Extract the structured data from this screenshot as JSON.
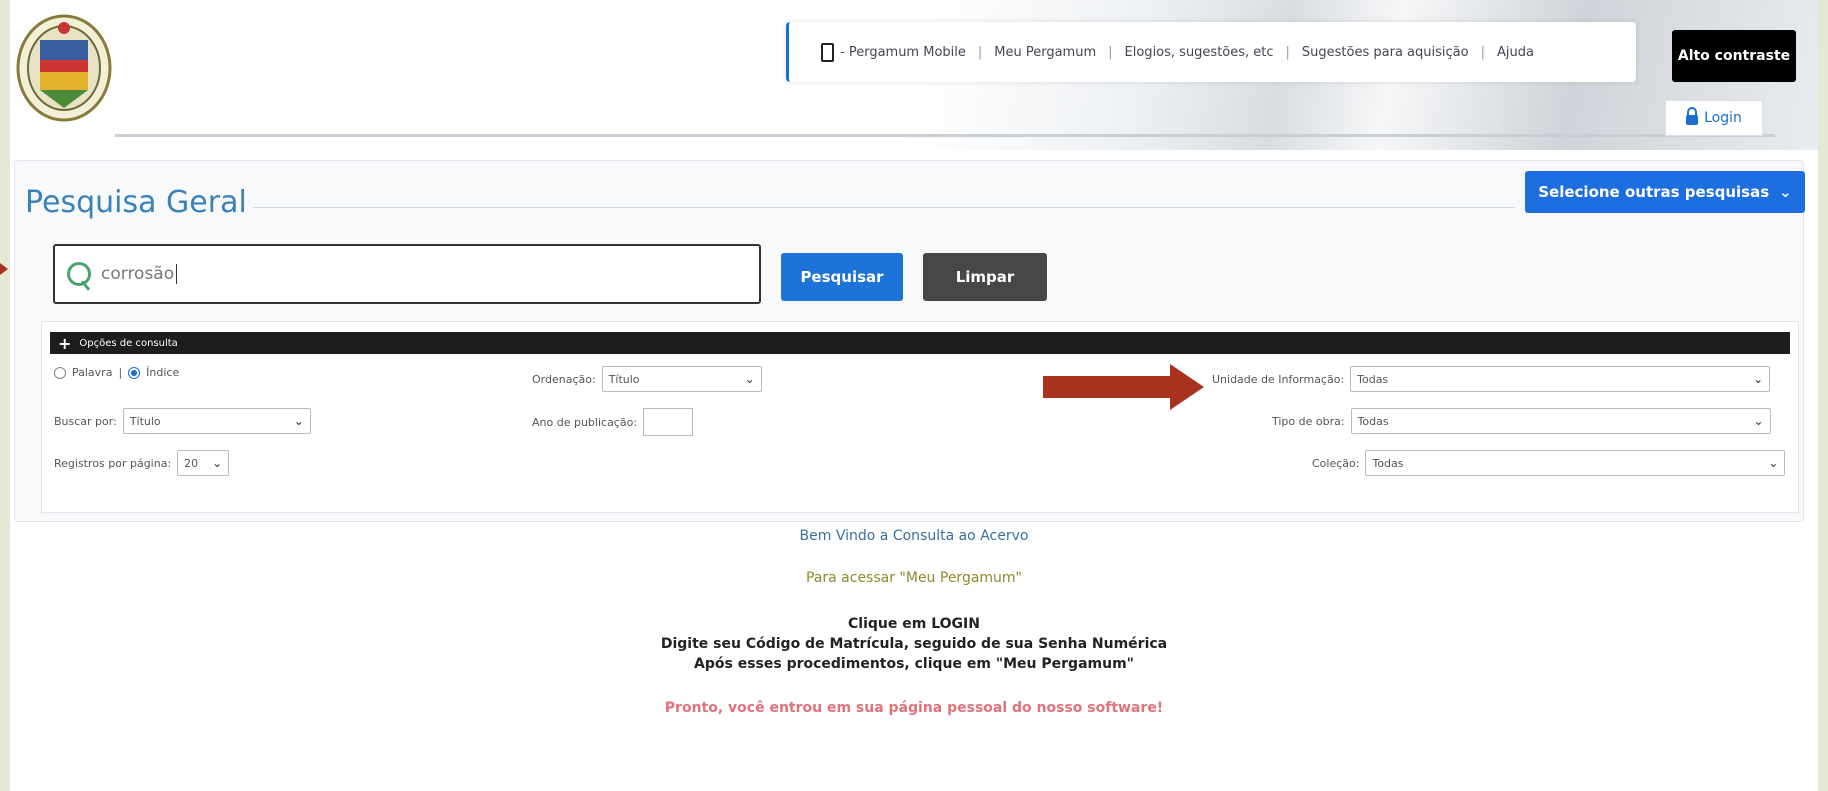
{
  "header": {
    "nav": [
      {
        "label": "- Pergamum Mobile"
      },
      {
        "label": "Meu Pergamum"
      },
      {
        "label": "Elogios, sugestões, etc"
      },
      {
        "label": "Sugestões para aquisição"
      },
      {
        "label": "Ajuda"
      }
    ],
    "high_contrast": "Alto contraste",
    "login": "Login"
  },
  "search": {
    "title": "Pesquisa Geral",
    "other_searches": "Selecione outras pesquisas",
    "query": "corrosão",
    "search_button": "Pesquisar",
    "clear_button": "Limpar"
  },
  "options": {
    "bar_label": "Opções de consulta",
    "radio_word": "Palavra",
    "radio_index": "Índice",
    "order_label": "Ordenação:",
    "order_value": "Título",
    "unit_label": "Unidade de Informação:",
    "unit_value": "Todas",
    "search_by_label": "Buscar por:",
    "search_by_value": "Título",
    "year_label": "Ano de publicação:",
    "year_value": "",
    "type_label": "Tipo de obra:",
    "type_value": "Todas",
    "per_page_label": "Registros por página:",
    "per_page_value": "20",
    "collection_label": "Coleção:",
    "collection_value": "Todas"
  },
  "welcome": {
    "line1": "Bem Vindo a Consulta ao Acervo",
    "line2": "Para acessar \"Meu Pergamum\"",
    "line3a": "Clique em LOGIN",
    "line3b": "Digite seu Código de Matrícula, seguido de sua Senha Numérica",
    "line3c": "Após esses procedimentos, clique em \"Meu Pergamum\"",
    "line4": "Pronto, você entrou em sua página pessoal do nosso software!"
  },
  "colors": {
    "accent": "#1d6fe0",
    "arrow": "#a8321e",
    "dark_button": "#474747"
  }
}
